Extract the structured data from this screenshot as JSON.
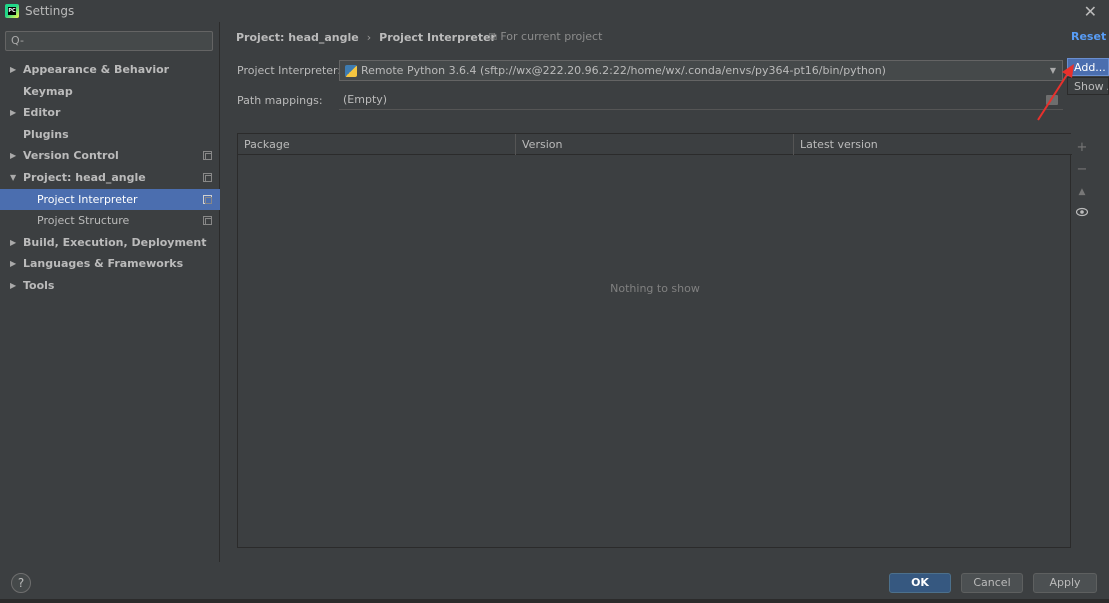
{
  "window": {
    "title": "Settings",
    "close_icon": "close-icon"
  },
  "search": {
    "placeholder": "Q-"
  },
  "sidebar": {
    "items": [
      {
        "label": "Appearance & Behavior",
        "expandable": true,
        "expanded": false,
        "bold": true,
        "copy": false
      },
      {
        "label": "Keymap",
        "expandable": false,
        "bold": true,
        "copy": false
      },
      {
        "label": "Editor",
        "expandable": true,
        "expanded": false,
        "bold": true,
        "copy": false
      },
      {
        "label": "Plugins",
        "expandable": false,
        "bold": true,
        "copy": false
      },
      {
        "label": "Version Control",
        "expandable": true,
        "expanded": false,
        "bold": true,
        "copy": true
      },
      {
        "label": "Project: head_angle",
        "expandable": true,
        "expanded": true,
        "bold": true,
        "copy": true
      },
      {
        "label": "Project Interpreter",
        "child": true,
        "selected": true,
        "copy": true
      },
      {
        "label": "Project Structure",
        "child": true,
        "copy": true
      },
      {
        "label": "Build, Execution, Deployment",
        "expandable": true,
        "expanded": false,
        "bold": true,
        "copy": false
      },
      {
        "label": "Languages & Frameworks",
        "expandable": true,
        "expanded": false,
        "bold": true,
        "copy": false
      },
      {
        "label": "Tools",
        "expandable": true,
        "expanded": false,
        "bold": true,
        "copy": false
      }
    ]
  },
  "header": {
    "breadcrumb_project": "Project: head_angle",
    "breadcrumb_sep": "›",
    "breadcrumb_page": "Project Interpreter",
    "for_current": "For current project",
    "reset": "Reset"
  },
  "interpreter": {
    "label": "Project Interpreter:",
    "value": "Remote Python 3.6.4 (sftp://wx@222.20.96.2:22/home/wx/.conda/envs/py364-pt16/bin/python)"
  },
  "path_mappings": {
    "label": "Path mappings:",
    "value": "(Empty)"
  },
  "gear_menu": {
    "add": "Add...",
    "show_all": "Show All..."
  },
  "table": {
    "columns": [
      "Package",
      "Version",
      "Latest version"
    ],
    "rows": [],
    "empty_text": "Nothing to show"
  },
  "footer": {
    "help": "?",
    "ok": "OK",
    "cancel": "Cancel",
    "apply": "Apply"
  },
  "colors": {
    "background": "#3c3f41",
    "selection": "#4b6eaf",
    "link": "#589df6",
    "annotation_arrow": "#e8302c"
  }
}
